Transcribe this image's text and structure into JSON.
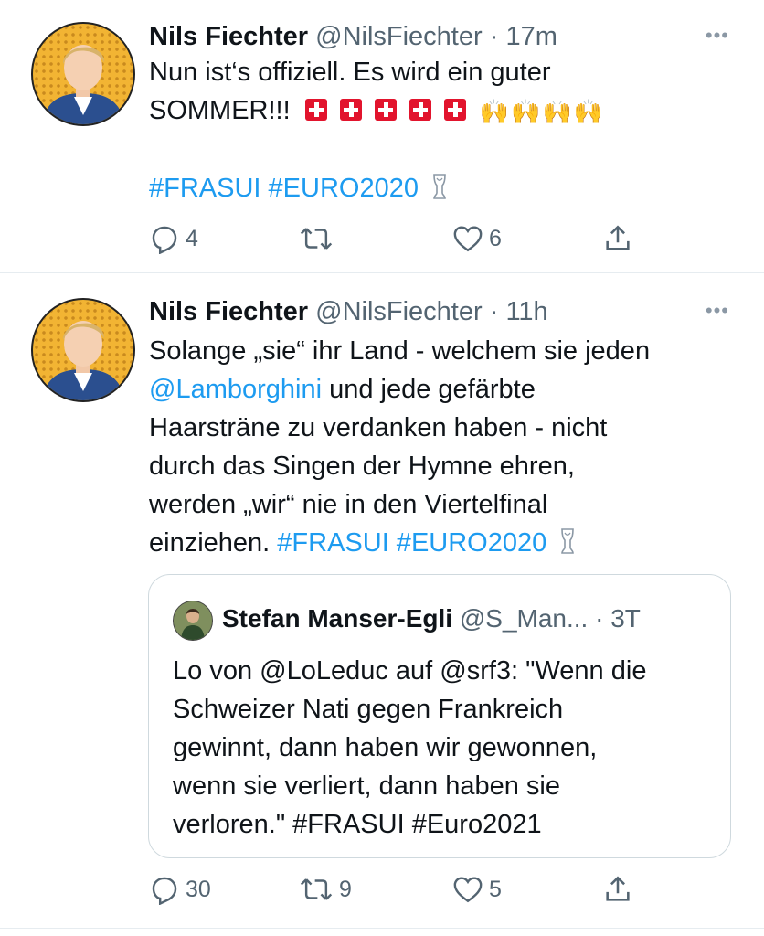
{
  "tweets": [
    {
      "name": "Nils Fiechter",
      "handle": "@NilsFiechter",
      "dot": "·",
      "time": "17m",
      "more": "•••",
      "line1": "Nun ist‘s offiziell. Es wird ein guter",
      "line2": "SOMMER!!!",
      "hashtags": "#FRASUI #EURO2020",
      "replies": "4",
      "retweets": "",
      "likes": "6"
    },
    {
      "name": "Nils Fiechter",
      "handle": "@NilsFiechter",
      "dot": "·",
      "time": "11h",
      "more": "•••",
      "line1": "Solange „sie“ ihr Land - welchem sie jeden",
      "mention": "@Lamborghini",
      "line2_rest": " und jede gefärbte",
      "line3": "Haarsträne zu verdanken haben - nicht",
      "line4": "durch das Singen der Hymne ehren,",
      "line5": "werden „wir“ nie in den Viertelfinal",
      "line6": "einziehen. ",
      "hashtags": "#FRASUI #EURO2020",
      "replies": "30",
      "retweets": "9",
      "likes": "5"
    }
  ],
  "quote": {
    "name": "Stefan Manser-Egli",
    "handle": "@S_Man...",
    "dot": "·",
    "time": "3T",
    "line1": "Lo von @LoLeduc auf @srf3: \"Wenn die",
    "line2": "Schweizer Nati gegen Frankreich",
    "line3": "gewinnt, dann haben wir gewonnen,",
    "line4": "wenn sie verliert, dann haben sie",
    "line5": "verloren.\" #FRASUI #Euro2021"
  },
  "icons": {
    "reply": "reply-icon",
    "retweet": "retweet-icon",
    "like": "heart-icon",
    "share": "share-icon",
    "flag": "swiss-flag-icon",
    "hands": "raising-hands-icon",
    "trophy": "trophy-icon"
  },
  "colors": {
    "link": "#1d9bf0",
    "muted": "#536471",
    "flag": "#e2142d"
  }
}
